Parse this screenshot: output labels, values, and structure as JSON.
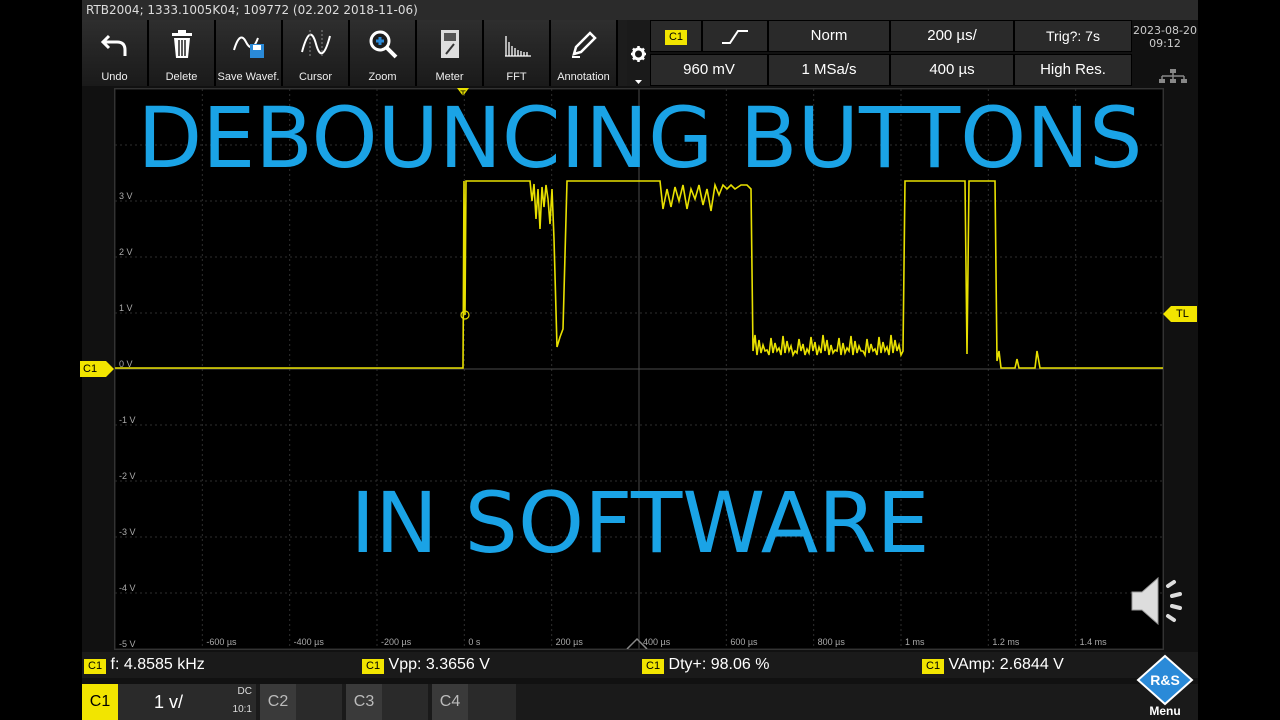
{
  "title_bar": "RTB2004; 1333.1005K04; 109772 (02.202 2018-11-06)",
  "toolbar": [
    {
      "label": "Undo",
      "icon": "undo-icon"
    },
    {
      "label": "Delete",
      "icon": "delete-icon"
    },
    {
      "label": "Save Wavef.",
      "icon": "save-waveform-icon"
    },
    {
      "label": "Cursor",
      "icon": "cursor-icon"
    },
    {
      "label": "Zoom",
      "icon": "zoom-icon"
    },
    {
      "label": "Meter",
      "icon": "meter-icon"
    },
    {
      "label": "FFT",
      "icon": "fft-icon"
    },
    {
      "label": "Annotation",
      "icon": "annotation-icon"
    }
  ],
  "info": {
    "channel": "C1",
    "trigger_slope": "rising-edge",
    "mode": "Norm",
    "timebase": "200 µs/",
    "trig_status": "Trig?: 7s",
    "level": "960 mV",
    "sample_rate": "1 MSa/s",
    "acq_time": "400 µs",
    "acq_mode": "High Res.",
    "date": "2023-08-20",
    "time": "09:12"
  },
  "overlay": {
    "line1": "DEBOUNCING BUTTONS",
    "line2": "IN SOFTWARE"
  },
  "plot": {
    "y_labels": [
      "3 V",
      "2 V",
      "1 V",
      "0 V",
      "-1 V",
      "-2 V",
      "-3 V",
      "-4 V",
      "-5 V"
    ],
    "x_labels": [
      "-600 µs",
      "-400 µs",
      "-200 µs",
      "0 s",
      "200 µs",
      "400 µs",
      "600 µs",
      "800 µs",
      "1 ms",
      "1.2 ms",
      "1.4 ms"
    ],
    "channel_marker": "C1",
    "trigger_level_marker": "TL",
    "trigger_pos_marker": "T",
    "trace_color": "#e8e000"
  },
  "measurements": [
    {
      "badge": "C1",
      "text": "f: 4.8585 kHz"
    },
    {
      "badge": "C1",
      "text": "Vpp: 3.3656 V"
    },
    {
      "badge": "C1",
      "text": "Dty+: 98.06 %"
    },
    {
      "badge": "C1",
      "text": "VAmp: 2.6844 V"
    }
  ],
  "channels": {
    "c1": {
      "label": "C1",
      "scale": "1 v/",
      "coupling": "DC",
      "probe": "10:1"
    },
    "c2": {
      "label": "C2"
    },
    "c3": {
      "label": "C3"
    },
    "c4": {
      "label": "C4"
    }
  },
  "menu_label": "Menu",
  "logo_text": "R&S"
}
